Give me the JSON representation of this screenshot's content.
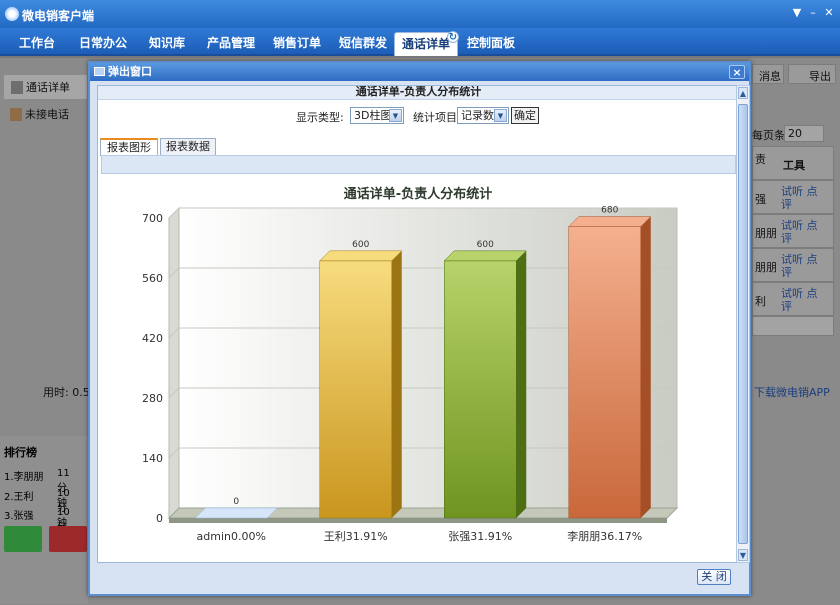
{
  "app": {
    "title": "微电销客户端"
  },
  "menu": {
    "items": [
      {
        "label": "工作台"
      },
      {
        "label": "日常办公"
      },
      {
        "label": "知识库"
      },
      {
        "label": "产品管理"
      },
      {
        "label": "销售订单"
      },
      {
        "label": "短信群发"
      },
      {
        "label": "通话详单"
      },
      {
        "label": "控制面板"
      }
    ],
    "active_index": 6
  },
  "left_nav": {
    "items": [
      {
        "label": "通话详单"
      },
      {
        "label": "未接电话"
      }
    ]
  },
  "background": {
    "elapsed_label": "用时: 0.5",
    "ranking_title": "排行榜",
    "ranking": [
      {
        "name": "1.李朋朋",
        "time": "11分钟"
      },
      {
        "name": "2.王利",
        "time": "10分钟"
      },
      {
        "name": "3.张强",
        "time": "10分钟"
      }
    ],
    "right_buttons": [
      "消息",
      "导出"
    ],
    "page_size_label": "每页条数:",
    "page_size_value": "20",
    "column_header_partial": "责",
    "tools_header": "工具",
    "rows": [
      {
        "name": "强",
        "actions": "试听 点评"
      },
      {
        "name": "朋朋",
        "actions": "试听 点评"
      },
      {
        "name": "朋朋",
        "actions": "试听 点评"
      },
      {
        "name": "利",
        "actions": "试听 点评"
      }
    ],
    "download_link": "下载微电销APP"
  },
  "popup": {
    "title": "弹出窗口",
    "close_symbol": "×",
    "report_title": "通话详单-负责人分布统计",
    "display_type_label": "显示类型:",
    "display_type_value": "3D柱图",
    "stat_item_label": "统计项目:",
    "stat_item_value": "记录数",
    "confirm_button": "确定",
    "tabs": [
      "报表图形",
      "报表数据"
    ],
    "active_tab": 0,
    "close_button": "关 闭"
  },
  "colors": {
    "accent_blue": "#2369c3",
    "bar_admin": "#b6d2f0",
    "bar_wangli": "#e2b32c",
    "bar_zhangqiang": "#8cb42c",
    "bar_lipengpeng": "#de7e4d"
  },
  "chart_data": {
    "type": "bar",
    "title": "通话详单-负责人分布统计",
    "categories": [
      "admin0.00%",
      "王利31.91%",
      "张强31.91%",
      "李朋朋36.17%"
    ],
    "values": [
      0,
      600,
      600,
      680
    ],
    "ylim": [
      0,
      700
    ],
    "yticks": [
      0,
      140,
      280,
      420,
      560,
      700
    ],
    "style": "3D",
    "grid": true,
    "legend": "none"
  }
}
